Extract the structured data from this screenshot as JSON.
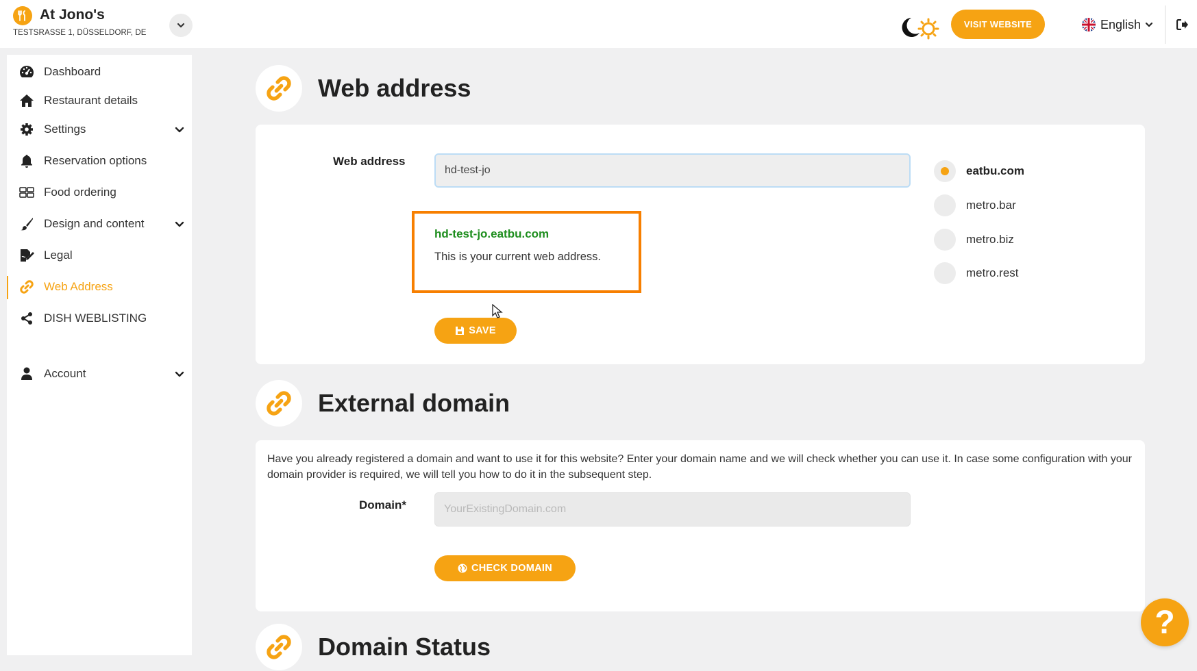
{
  "brand": {
    "name": "At Jono's",
    "address": "TESTSRASSE 1, DÜSSELDORF, DE"
  },
  "topbar": {
    "visit_website": "VISIT WEBSITE",
    "language": "English"
  },
  "sidebar": {
    "items": [
      {
        "label": "Dashboard",
        "icon": "gauge-icon"
      },
      {
        "label": "Restaurant details",
        "icon": "home-icon"
      },
      {
        "label": "Settings",
        "icon": "gear-icon",
        "expandable": true
      },
      {
        "label": "Reservation options",
        "icon": "bell-icon"
      },
      {
        "label": "Food ordering",
        "icon": "food-icon"
      },
      {
        "label": "Design and content",
        "icon": "brush-icon",
        "expandable": true
      },
      {
        "label": "Legal",
        "icon": "document-signature-icon"
      },
      {
        "label": "Web Address",
        "icon": "link-icon",
        "active": true
      },
      {
        "label": "DISH WEBLISTING",
        "icon": "share-icon"
      },
      {
        "label": "Account",
        "icon": "user-icon",
        "expandable": true
      }
    ]
  },
  "web_address": {
    "title": "Web address",
    "field_label": "Web address",
    "value": "hd-test-jo",
    "current_url": "hd-test-jo.eatbu.com",
    "current_note": "This is your current web address.",
    "save_label": "SAVE",
    "domains": [
      {
        "label": "eatbu.com",
        "selected": true
      },
      {
        "label": "metro.bar",
        "selected": false
      },
      {
        "label": "metro.biz",
        "selected": false
      },
      {
        "label": "metro.rest",
        "selected": false
      }
    ]
  },
  "external_domain": {
    "title": "External domain",
    "description": "Have you already registered a domain and want to use it for this website? Enter your domain name and we will check whether you can use it. In case some configuration with your domain provider is required, we will tell you how to do it in the subsequent step.",
    "field_label": "Domain*",
    "placeholder": "YourExistingDomain.com",
    "value": "",
    "check_label": "CHECK DOMAIN"
  },
  "domain_status": {
    "title": "Domain Status"
  },
  "help": {
    "label": "?"
  },
  "colors": {
    "accent": "#f6a313",
    "highlight_border": "#f77f00",
    "url_green": "#1e8e1e"
  }
}
